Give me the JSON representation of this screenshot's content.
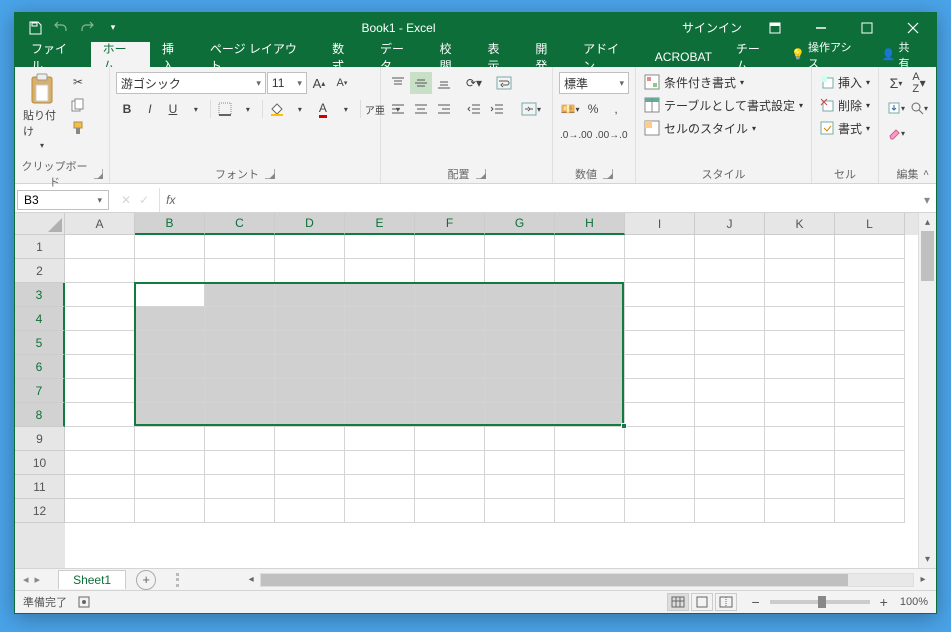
{
  "titlebar": {
    "title": "Book1  -  Excel",
    "signin": "サインイン"
  },
  "tabs": {
    "items": [
      "ファイル",
      "ホーム",
      "挿入",
      "ページ レイアウト",
      "数式",
      "データ",
      "校閲",
      "表示",
      "開発",
      "アドイン",
      "ACROBAT",
      "チーム"
    ],
    "activeIndex": 1,
    "tell": "操作アシス",
    "share": "共有"
  },
  "ribbon": {
    "clipboard": {
      "paste": "貼り付け",
      "label": "クリップボード"
    },
    "font": {
      "name": "游ゴシック",
      "size": "11",
      "label": "フォント",
      "bold": "B",
      "italic": "I",
      "underline": "U",
      "ruby": "ア亜"
    },
    "alignment": {
      "label": "配置"
    },
    "number": {
      "format": "標準",
      "label": "数値"
    },
    "styles": {
      "cond": "条件付き書式",
      "table": "テーブルとして書式設定",
      "cell": "セルのスタイル",
      "label": "スタイル"
    },
    "cells": {
      "insert": "挿入",
      "delete": "削除",
      "format": "書式",
      "label": "セル"
    },
    "editing": {
      "label": "編集"
    }
  },
  "formulabar": {
    "name": "B3",
    "fx": "fx",
    "value": ""
  },
  "grid": {
    "cols": [
      "A",
      "B",
      "C",
      "D",
      "E",
      "F",
      "G",
      "H",
      "I",
      "J",
      "K",
      "L"
    ],
    "rows": [
      "1",
      "2",
      "3",
      "4",
      "5",
      "6",
      "7",
      "8",
      "9",
      "10",
      "11",
      "12"
    ],
    "selColsStart": 1,
    "selColsEnd": 7,
    "selRowsStart": 2,
    "selRowsEnd": 7,
    "activeCell": "B3"
  },
  "sheets": {
    "tab": "Sheet1"
  },
  "statusbar": {
    "ready": "準備完了",
    "zoom": "100%"
  }
}
